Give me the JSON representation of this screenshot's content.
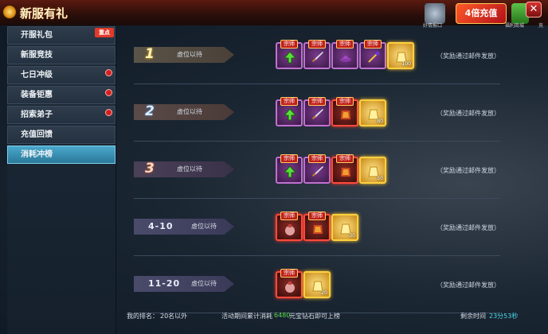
{
  "window": {
    "title": "新服有礼"
  },
  "topbar": {
    "icon1_label": "好情报口",
    "recharge_label": "4倍充值",
    "icon3_label": "福利商城",
    "icon4_label": "充"
  },
  "sidebar": {
    "hot_tag": "重点",
    "items": [
      {
        "label": "开服礼包",
        "badge": false,
        "hot": true
      },
      {
        "label": "新服竞技",
        "badge": false
      },
      {
        "label": "七日冲级",
        "badge": true
      },
      {
        "label": "装备钜惠",
        "badge": true
      },
      {
        "label": "招索弟子",
        "badge": true
      },
      {
        "label": "充值回馈",
        "badge": false
      },
      {
        "label": "消耗冲榜",
        "badge": false,
        "active": true
      }
    ]
  },
  "rows": [
    {
      "rank": "1",
      "status": "虚位以待",
      "mail_note": "（奖励通过邮件发放）",
      "rewards": [
        {
          "type": "purple",
          "tag": "宗师",
          "icon": "arrow-up-icon"
        },
        {
          "type": "purple",
          "tag": "宗师",
          "icon": "sword-icon"
        },
        {
          "type": "purple",
          "tag": "宗师",
          "icon": "hat-icon"
        },
        {
          "type": "purple",
          "tag": "宗师",
          "icon": "staff-icon"
        },
        {
          "type": "gold",
          "tag": "",
          "icon": "gold-ingot-icon",
          "qty": "100"
        }
      ]
    },
    {
      "rank": "2",
      "status": "虚位以待",
      "mail_note": "（奖励通过邮件发放）",
      "rewards": [
        {
          "type": "purple",
          "tag": "宗师",
          "icon": "arrow-up-icon"
        },
        {
          "type": "purple",
          "tag": "宗师",
          "icon": "sword-icon"
        },
        {
          "type": "red",
          "tag": "宗师",
          "icon": "armor-icon"
        },
        {
          "type": "gold",
          "tag": "",
          "icon": "gold-ingot-icon",
          "qty": "80"
        }
      ]
    },
    {
      "rank": "3",
      "status": "虚位以待",
      "mail_note": "（奖励通过邮件发放）",
      "rewards": [
        {
          "type": "purple",
          "tag": "宗师",
          "icon": "arrow-up-icon"
        },
        {
          "type": "purple",
          "tag": "宗师",
          "icon": "sword-icon"
        },
        {
          "type": "red",
          "tag": "宗师",
          "icon": "armor-icon"
        },
        {
          "type": "gold",
          "tag": "",
          "icon": "gold-ingot-icon",
          "qty": "50"
        }
      ]
    },
    {
      "rank": "4-10",
      "status": "虚位以待",
      "mail_note": "（奖励通过邮件发放）",
      "rewards": [
        {
          "type": "red",
          "tag": "宗师",
          "icon": "bag-icon"
        },
        {
          "type": "red",
          "tag": "宗师",
          "icon": "armor-icon"
        },
        {
          "type": "gold",
          "tag": "",
          "icon": "gold-ingot-icon",
          "qty": "30"
        }
      ]
    },
    {
      "rank": "11-20",
      "status": "虚位以待",
      "mail_note": "（奖励通过邮件发放）",
      "rewards": [
        {
          "type": "red",
          "tag": "宗师",
          "icon": "bag-icon"
        },
        {
          "type": "gold",
          "tag": "",
          "icon": "gold-ingot-icon",
          "qty": "20"
        }
      ]
    }
  ],
  "footer": {
    "my_rank_label": "我的排名：",
    "my_rank_value": "20名以外",
    "rule_prefix": "活动期间累计消耗",
    "rule_amount": "6480",
    "rule_suffix": "元宝钻石即可上榜",
    "time_label": "剩余时间",
    "time_value": "23分53秒"
  },
  "colors": {
    "accent": "#4aa8cc",
    "gold": "#ffd040",
    "red": "#ff4a3a",
    "purple": "#c070d0"
  }
}
